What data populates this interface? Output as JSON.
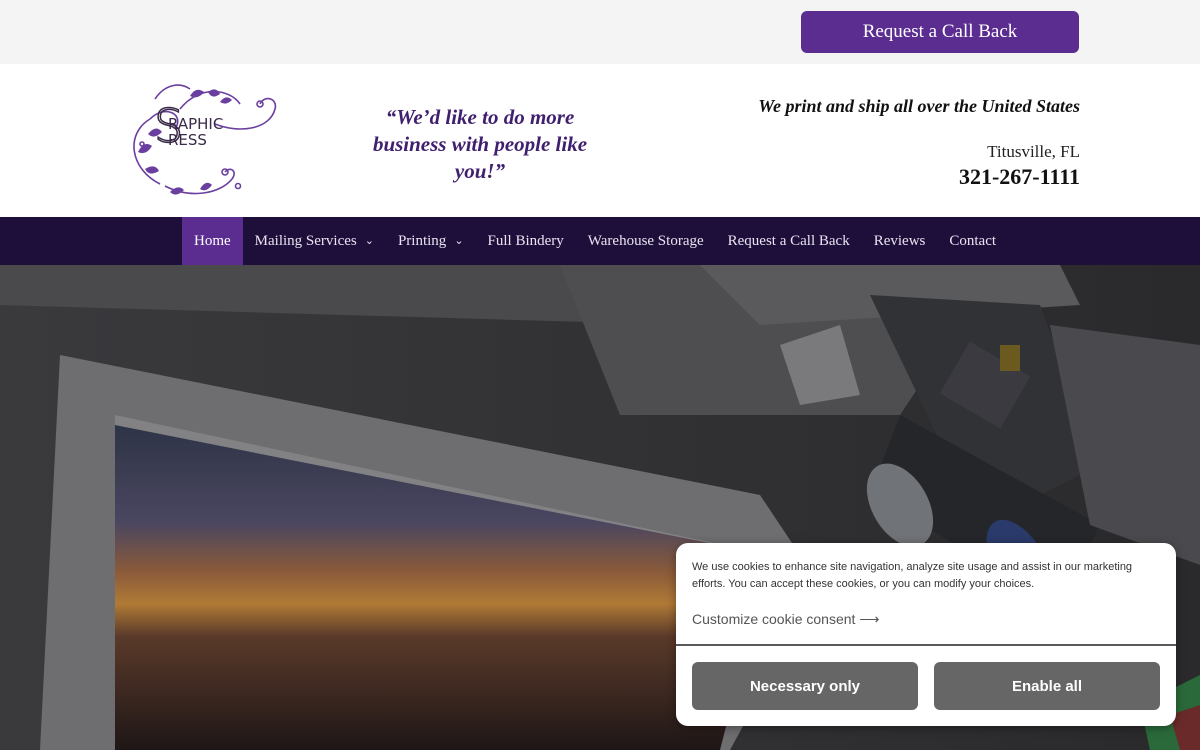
{
  "topbar": {
    "callback_label": "Request a Call Back"
  },
  "header": {
    "logo_text": "Graphic Press",
    "tagline": "“We’d like to do more business with people like you!”",
    "ship_text": "We print and ship all over the United States",
    "city": "Titusville, FL",
    "phone": "321-267-1111"
  },
  "nav": {
    "items": [
      {
        "label": "Home",
        "active": true
      },
      {
        "label": "Mailing Services",
        "dropdown": true
      },
      {
        "label": "Printing",
        "dropdown": true
      },
      {
        "label": "Full Bindery"
      },
      {
        "label": "Warehouse Storage"
      },
      {
        "label": "Request a Call Back"
      },
      {
        "label": "Reviews"
      },
      {
        "label": "Contact"
      }
    ]
  },
  "cookie": {
    "message": "We use cookies to enhance site navigation, analyze site usage and assist in our marketing efforts. You can accept these cookies, or you can modify your choices.",
    "customize_label": "Customize cookie consent",
    "customize_arrow": "⟶",
    "necessary_label": "Necessary only",
    "enable_label": "Enable all"
  },
  "colors": {
    "brand_purple": "#5b2d91",
    "nav_bg": "#1e0f3a",
    "tagline": "#3f1f6e",
    "cookie_button": "#666666"
  },
  "icons": {
    "dropdown": "chevron-down-icon",
    "arrow": "arrow-right-icon"
  }
}
